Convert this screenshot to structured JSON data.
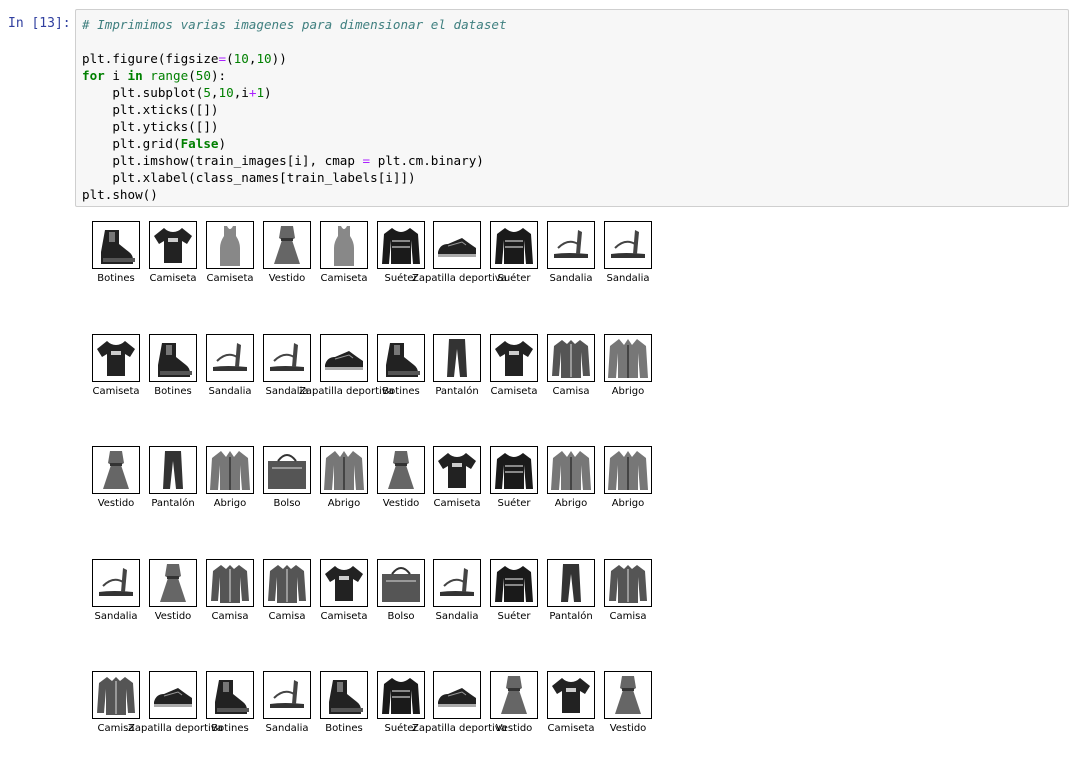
{
  "cell": {
    "prompt": "In [13]:",
    "code_lines": [
      [
        {
          "t": "# Imprimimos varias imagenes para dimensionar el dataset",
          "c": "cm-comment"
        }
      ],
      [
        {
          "t": "",
          "c": ""
        }
      ],
      [
        {
          "t": "plt.figure(figsize",
          "c": ""
        },
        {
          "t": "=",
          "c": "cm-op"
        },
        {
          "t": "(",
          "c": ""
        },
        {
          "t": "10",
          "c": "cm-number"
        },
        {
          "t": ",",
          "c": ""
        },
        {
          "t": "10",
          "c": "cm-number"
        },
        {
          "t": "))",
          "c": ""
        }
      ],
      [
        {
          "t": "for",
          "c": "cm-keyword"
        },
        {
          "t": " i ",
          "c": ""
        },
        {
          "t": "in",
          "c": "cm-keyword"
        },
        {
          "t": " ",
          "c": ""
        },
        {
          "t": "range",
          "c": "cm-builtin"
        },
        {
          "t": "(",
          "c": ""
        },
        {
          "t": "50",
          "c": "cm-number"
        },
        {
          "t": "):",
          "c": ""
        }
      ],
      [
        {
          "t": "    plt.subplot(",
          "c": ""
        },
        {
          "t": "5",
          "c": "cm-number"
        },
        {
          "t": ",",
          "c": ""
        },
        {
          "t": "10",
          "c": "cm-number"
        },
        {
          "t": ",i",
          "c": ""
        },
        {
          "t": "+",
          "c": "cm-op"
        },
        {
          "t": "1",
          "c": "cm-number"
        },
        {
          "t": ")",
          "c": ""
        }
      ],
      [
        {
          "t": "    plt.xticks([])",
          "c": ""
        }
      ],
      [
        {
          "t": "    plt.yticks([])",
          "c": ""
        }
      ],
      [
        {
          "t": "    plt.grid(",
          "c": ""
        },
        {
          "t": "False",
          "c": "cm-kwconst"
        },
        {
          "t": ")",
          "c": ""
        }
      ],
      [
        {
          "t": "    plt.imshow(train_images[i], cmap ",
          "c": ""
        },
        {
          "t": "=",
          "c": "cm-op"
        },
        {
          "t": " plt.cm.binary)",
          "c": ""
        }
      ],
      [
        {
          "t": "    plt.xlabel(class_names[train_labels[i]])",
          "c": ""
        }
      ],
      [
        {
          "t": "plt.show()",
          "c": ""
        }
      ]
    ]
  },
  "output": {
    "rows": [
      [
        {
          "label": "Botines",
          "icon": "ankle-boot-icon"
        },
        {
          "label": "Camiseta",
          "icon": "tshirt-icon"
        },
        {
          "label": "Camiseta",
          "icon": "tank-top-icon"
        },
        {
          "label": "Vestido",
          "icon": "dress-icon"
        },
        {
          "label": "Camiseta",
          "icon": "tank-top-icon"
        },
        {
          "label": "Suéter",
          "icon": "sweater-icon"
        },
        {
          "label": "Zapatilla deportiva",
          "icon": "sneaker-icon"
        },
        {
          "label": "Suéter",
          "icon": "sweater-icon"
        },
        {
          "label": "Sandalia",
          "icon": "sandal-icon"
        },
        {
          "label": "Sandalia",
          "icon": "sandal-icon"
        }
      ],
      [
        {
          "label": "Camiseta",
          "icon": "tshirt-icon"
        },
        {
          "label": "Botines",
          "icon": "ankle-boot-icon"
        },
        {
          "label": "Sandalia",
          "icon": "sandal-icon"
        },
        {
          "label": "Sandalia",
          "icon": "sandal-icon"
        },
        {
          "label": "Zapatilla deportiva",
          "icon": "sneaker-icon"
        },
        {
          "label": "Botines",
          "icon": "ankle-boot-icon"
        },
        {
          "label": "Pantalón",
          "icon": "trouser-icon"
        },
        {
          "label": "Camiseta",
          "icon": "tshirt-icon"
        },
        {
          "label": "Camisa",
          "icon": "shirt-icon"
        },
        {
          "label": "Abrigo",
          "icon": "coat-icon"
        }
      ],
      [
        {
          "label": "Vestido",
          "icon": "dress-icon"
        },
        {
          "label": "Pantalón",
          "icon": "trouser-icon"
        },
        {
          "label": "Abrigo",
          "icon": "coat-icon"
        },
        {
          "label": "Bolso",
          "icon": "bag-icon"
        },
        {
          "label": "Abrigo",
          "icon": "coat-icon"
        },
        {
          "label": "Vestido",
          "icon": "dress-icon"
        },
        {
          "label": "Camiseta",
          "icon": "tshirt-icon"
        },
        {
          "label": "Suéter",
          "icon": "sweater-icon"
        },
        {
          "label": "Abrigo",
          "icon": "coat-icon"
        },
        {
          "label": "Abrigo",
          "icon": "coat-icon"
        }
      ],
      [
        {
          "label": "Sandalia",
          "icon": "sandal-icon"
        },
        {
          "label": "Vestido",
          "icon": "dress-icon"
        },
        {
          "label": "Camisa",
          "icon": "shirt-icon"
        },
        {
          "label": "Camisa",
          "icon": "shirt-icon"
        },
        {
          "label": "Camiseta",
          "icon": "tshirt-icon"
        },
        {
          "label": "Bolso",
          "icon": "bag-icon"
        },
        {
          "label": "Sandalia",
          "icon": "sandal-icon"
        },
        {
          "label": "Suéter",
          "icon": "sweater-icon"
        },
        {
          "label": "Pantalón",
          "icon": "trouser-icon"
        },
        {
          "label": "Camisa",
          "icon": "shirt-icon"
        }
      ],
      [
        {
          "label": "Camisa",
          "icon": "shirt-icon"
        },
        {
          "label": "Zapatilla deportiva",
          "icon": "sneaker-icon"
        },
        {
          "label": "Botines",
          "icon": "ankle-boot-icon"
        },
        {
          "label": "Sandalia",
          "icon": "sandal-icon"
        },
        {
          "label": "Botines",
          "icon": "ankle-boot-icon"
        },
        {
          "label": "Suéter",
          "icon": "sweater-icon"
        },
        {
          "label": "Zapatilla deportiva",
          "icon": "sneaker-icon"
        },
        {
          "label": "Vestido",
          "icon": "dress-icon"
        },
        {
          "label": "Camiseta",
          "icon": "tshirt-icon"
        },
        {
          "label": "Vestido",
          "icon": "dress-icon"
        }
      ]
    ]
  },
  "colors": {
    "prompt": "#303f9f",
    "input_bg": "#f7f7f7",
    "input_border": "#cfcfcf",
    "tile_border": "#000000"
  }
}
